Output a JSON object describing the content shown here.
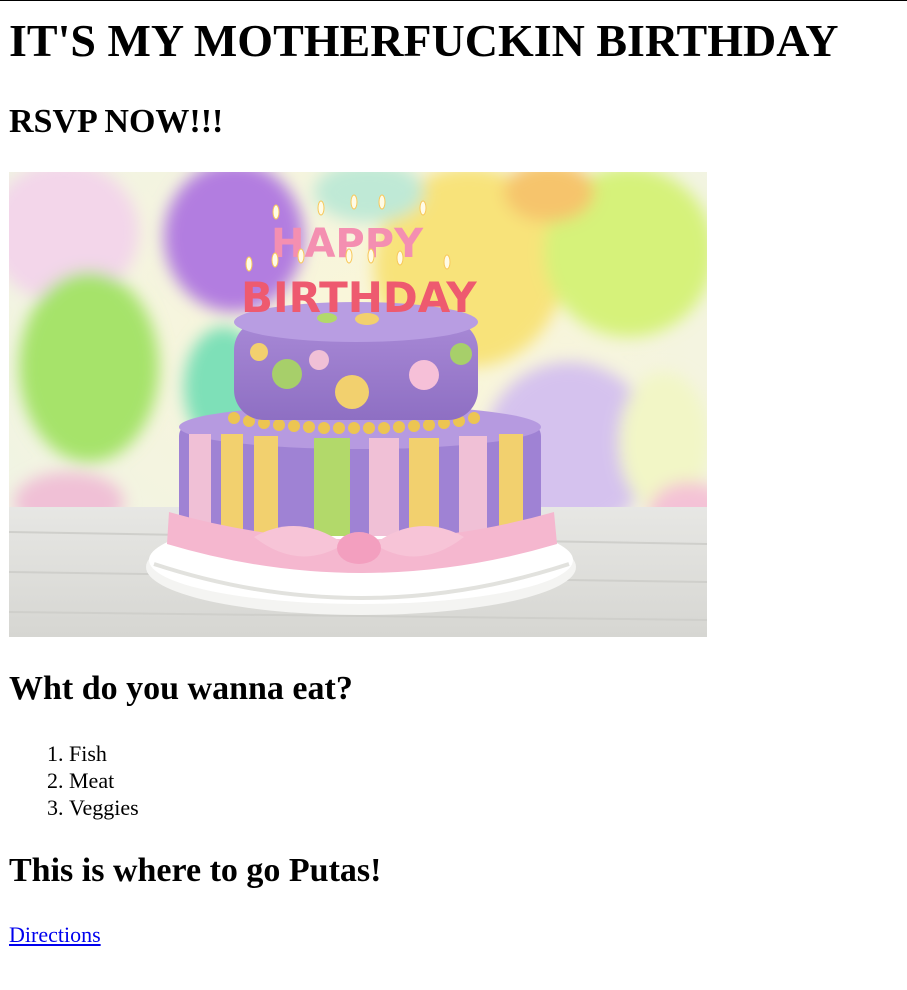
{
  "page": {
    "title": "IT'S MY MOTHERFUCKIN BIRTHDAY",
    "rsvp": "RSVP NOW!!!",
    "image": {
      "cake_text_line1": "HAPPY",
      "cake_text_line2": "BIRTHDAY"
    },
    "food_heading": "Wht do you wanna eat?",
    "food_options": [
      "Fish",
      "Meat",
      "Veggies"
    ],
    "where_heading": "This is where to go Putas!",
    "directions_link": "Directions"
  },
  "colors": {
    "link": "#0000ee",
    "text": "#000000"
  }
}
